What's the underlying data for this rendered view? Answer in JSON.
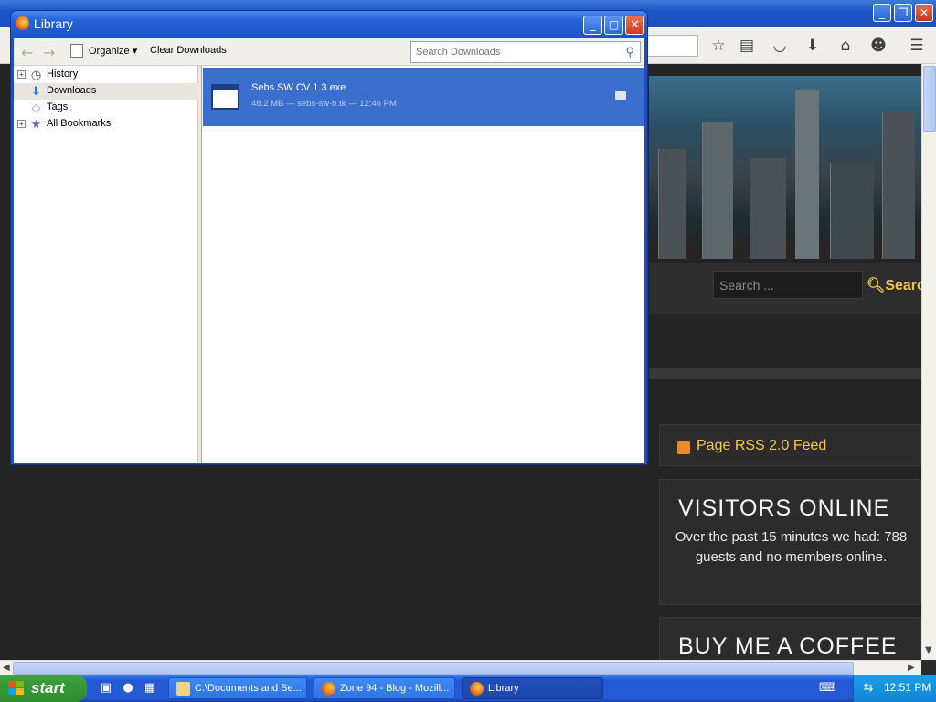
{
  "browser": {
    "tb_icons": [
      "bookmark-star-icon",
      "reading-list-icon",
      "pocket-icon",
      "download-icon",
      "home-icon",
      "smiley-icon",
      "hamburger-menu-icon"
    ]
  },
  "website": {
    "search_placeholder": "Search ...",
    "search_button": "Searc",
    "rss_label": "Page RSS 2.0 Feed",
    "visitors_title": "VISITORS ONLINE",
    "visitors_text": "Over the past 15 minutes we had: 788 guests and no members online.",
    "coffee_title": "BUY ME A COFFEE"
  },
  "library": {
    "title": "Library",
    "toolbar": {
      "organize_label": "Organize",
      "clear_downloads_label": "Clear Downloads",
      "search_placeholder": "Search Downloads"
    },
    "tree": [
      {
        "label": "History",
        "icon": "clock-icon",
        "expandable": true
      },
      {
        "label": "Downloads",
        "icon": "download-arrow-icon",
        "expandable": false,
        "selected": true
      },
      {
        "label": "Tags",
        "icon": "tag-icon",
        "expandable": false
      },
      {
        "label": "All Bookmarks",
        "icon": "bookmarks-star-icon",
        "expandable": true
      }
    ],
    "downloads": [
      {
        "name": "Sebs SW CV 1.3.exe",
        "meta": "48.2 MB — sebs-sw-b.tk — 12:46 PM"
      }
    ]
  },
  "taskbar": {
    "start_label": "start",
    "tasks": [
      {
        "label": "C:\\Documents and Se...",
        "icon": "folder-icon",
        "active": false
      },
      {
        "label": "Zone 94 - Blog - Mozill...",
        "icon": "firefox-icon",
        "active": false
      },
      {
        "label": "Library",
        "icon": "firefox-icon",
        "active": true
      }
    ],
    "clock": "12:51 PM"
  },
  "colors": {
    "xp_blue": "#245ad6",
    "selection_blue": "#3a6fcd",
    "site_accent": "#f2c84c",
    "start_green": "#369b36"
  }
}
